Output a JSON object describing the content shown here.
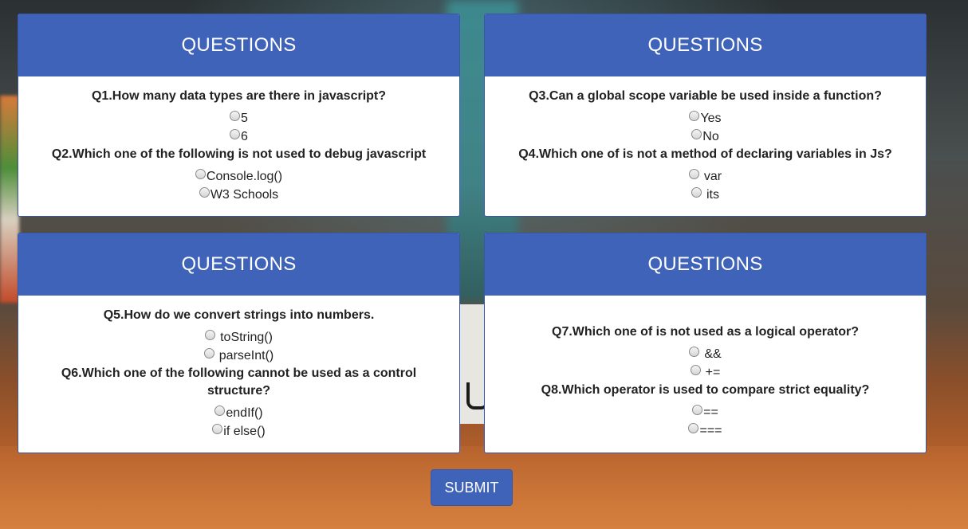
{
  "quiz": {
    "cards": [
      {
        "header": "QUESTIONS",
        "questions": [
          {
            "text": "Q1.How many data types are there in javascript?",
            "options": [
              "5",
              "6"
            ]
          },
          {
            "text": "Q2.Which one of the following is not used to debug javascript",
            "options": [
              "Console.log()",
              "W3 Schools"
            ]
          }
        ]
      },
      {
        "header": "QUESTIONS",
        "questions": [
          {
            "text": "Q3.Can a global scope variable be used inside a function?",
            "options": [
              "Yes",
              "No"
            ]
          },
          {
            "text": "Q4.Which one of is not a method of declaring variables in Js?",
            "options": [
              "var",
              "its"
            ]
          }
        ]
      },
      {
        "header": "QUESTIONS",
        "questions": [
          {
            "text": "Q5.How do we convert strings into numbers.",
            "options": [
              "toString()",
              "parseInt()"
            ]
          },
          {
            "text": "Q6.Which one of the following cannot be used as a control structure?",
            "options": [
              "endIf()",
              "if else()"
            ]
          }
        ]
      },
      {
        "header": "QUESTIONS",
        "questions": [
          {
            "text": "Q7.Which one of is not used as a logical operator?",
            "options": [
              "&&",
              "+="
            ]
          },
          {
            "text": "Q8.Which operator is used to compare strict equality?",
            "options": [
              "==",
              "==="
            ]
          }
        ]
      }
    ],
    "submit_label": "SUBMIT"
  },
  "colors": {
    "header_blue": "#4063ba",
    "card_bg": "#ffffff",
    "text": "#222222"
  }
}
